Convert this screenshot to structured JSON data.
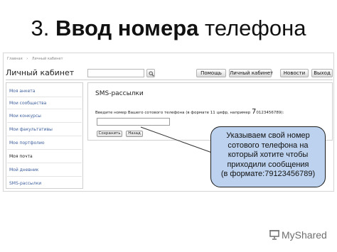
{
  "slide": {
    "title_number": "3.",
    "title_bold": "Ввод номера",
    "title_rest": "телефона"
  },
  "breadcrumbs": [
    "Главная",
    "Личный кабинет"
  ],
  "header": {
    "title": "Личный кабинет",
    "search_placeholder": "",
    "nav": [
      {
        "label": "Помощь"
      },
      {
        "label": "Личный кабинет"
      },
      {
        "label": "Новости"
      },
      {
        "label": "Выход"
      }
    ]
  },
  "sidebar": {
    "items": [
      {
        "label": "Моя анкета"
      },
      {
        "label": "Мои сообщества"
      },
      {
        "label": "Мои конкурсы"
      },
      {
        "label": "Мои факультативы"
      },
      {
        "label": "Мое портфолио"
      },
      {
        "label": "Моя почта"
      },
      {
        "label": "Мой дневник"
      },
      {
        "label": "SMS-рассылки"
      }
    ]
  },
  "panel": {
    "title": "SMS-рассылки",
    "prompt_prefix": "Введите номер Вашего сотового телефона (в формате 11 цифр, например ",
    "prompt_example_first": "7",
    "prompt_example_rest": "0123456789):",
    "phone_value": "",
    "save_label": "Сохранить",
    "back_label": "Назад"
  },
  "callout": {
    "text": "Указываем свой номер\nсотового телефона на\nкоторый хотите чтобы\nприходили сообщения\n(в формате:79123456789)"
  },
  "watermark": {
    "text": "MyShared"
  },
  "colors": {
    "callout_fill": "#bcd2ee",
    "link": "#3d5f9c"
  }
}
